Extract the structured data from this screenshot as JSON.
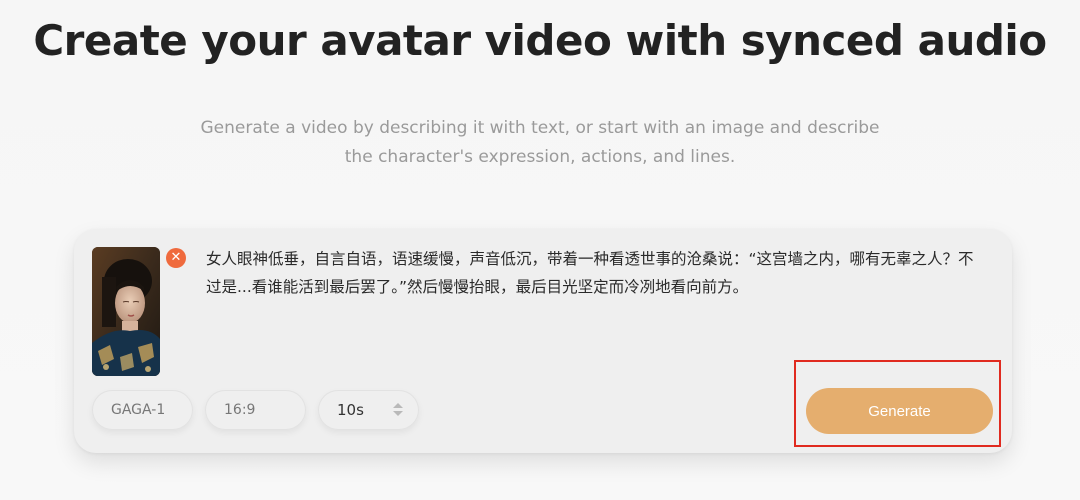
{
  "header": {
    "title": "Create your avatar video with synced audio",
    "subtitle": "Generate a video by describing it with text, or start with an image and describe the character's expression, actions, and lines."
  },
  "composer": {
    "image": {
      "remove_icon": "close-icon",
      "remove_glyph": "✕"
    },
    "prompt_text": "女人眼神低垂，自言自语，语速缓慢，声音低沉，带着一种看透世事的沧桑说：“这宫墙之内，哪有无辜之人？不过是...看谁能活到最后罢了。”然后慢慢抬眼，最后目光坚定而冷冽地看向前方。",
    "model": "GAGA-1",
    "aspect_ratio": "16:9",
    "duration": "10s",
    "generate_label": "Generate"
  },
  "colors": {
    "accent": "#e5ae6e",
    "remove_badge": "#ef6a3d",
    "highlight_box": "#e02a1f"
  }
}
